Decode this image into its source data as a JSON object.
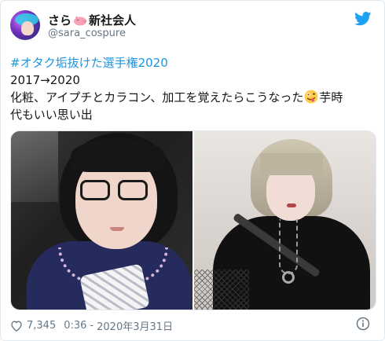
{
  "user": {
    "display_name_before": "さら",
    "display_name_after": "新社会人",
    "handle": "@sara_cospure",
    "avatar_icon": "avatar"
  },
  "tweet": {
    "hashtag": "#オタク垢抜けた選手権2020",
    "line1": "2017→2020",
    "line2_before": "化粧、アイプチとカラコン、加工を覚えたらこうなった",
    "line2_after": "芋時",
    "line3": "代もいい思い出",
    "emoji": "zany-face-icon"
  },
  "meta": {
    "likes": "7,345",
    "time": "0:36",
    "separator": "-",
    "date": "2020年3月31日"
  },
  "colors": {
    "link": "#1b95e0",
    "twitter_blue": "#1da1f2",
    "muted": "#657786"
  },
  "icons": [
    "pig-icon",
    "twitter-bird-icon",
    "heart-icon",
    "info-icon",
    "zany-face-icon"
  ]
}
